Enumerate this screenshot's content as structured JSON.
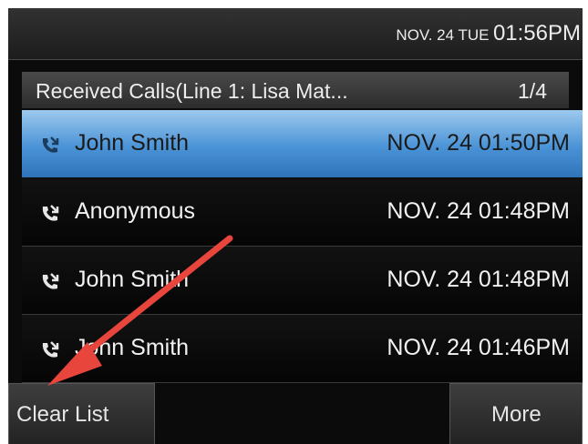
{
  "status_bar": {
    "date": "NOV. 24 TUE",
    "time": "01:56PM"
  },
  "list": {
    "title": "Received Calls(Line 1: Lisa Mat...",
    "page": "1/4",
    "rows": [
      {
        "name": "John Smith",
        "time": "NOV. 24 01:50PM",
        "icon": "received-call-icon"
      },
      {
        "name": "Anonymous",
        "time": "NOV. 24 01:48PM",
        "icon": "received-call-icon"
      },
      {
        "name": "John Smith",
        "time": "NOV. 24 01:48PM",
        "icon": "received-call-icon"
      },
      {
        "name": "John Smith",
        "time": "NOV. 24 01:46PM",
        "icon": "received-call-icon"
      }
    ]
  },
  "softkeys": {
    "clear_list": "Clear List",
    "more": "More"
  },
  "colors": {
    "selected_row": "#4a93d6",
    "annotation_arrow": "#e8453c"
  }
}
